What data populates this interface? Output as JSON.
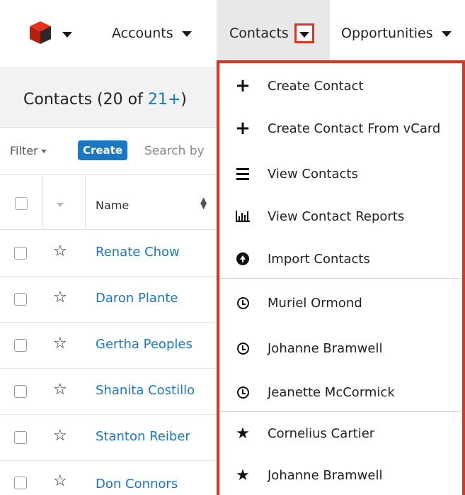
{
  "nav": {
    "logo": "sugar-cube-logo",
    "items": [
      {
        "label": "Accounts"
      },
      {
        "label": "Contacts"
      },
      {
        "label": "Opportunities"
      }
    ]
  },
  "list": {
    "title_prefix": "Contacts (20 of ",
    "title_count": "21+",
    "title_suffix": ")",
    "filter_label": "Filter",
    "create_label": "Create",
    "search_placeholder": "Search by",
    "name_column": "Name",
    "rows": [
      {
        "name": "Renate Chow"
      },
      {
        "name": "Daron Plante"
      },
      {
        "name": "Gertha Peoples"
      },
      {
        "name": "Shanita Costillo"
      },
      {
        "name": "Stanton Reiber"
      },
      {
        "name": "Don Connors"
      }
    ]
  },
  "menu": {
    "items": [
      {
        "label": "Create Contact",
        "icon": "plus-icon"
      },
      {
        "label": "Create Contact From vCard",
        "icon": "plus-icon"
      },
      {
        "label": "View Contacts",
        "icon": "list-icon"
      },
      {
        "label": "View Contact Reports",
        "icon": "bar-chart-icon"
      },
      {
        "label": "Import Contacts",
        "icon": "upload-circle-icon"
      },
      {
        "label": "Muriel Ormond",
        "icon": "clock-icon"
      },
      {
        "label": "Johanne Bramwell",
        "icon": "clock-icon"
      },
      {
        "label": "Jeanette McCormick",
        "icon": "clock-icon"
      },
      {
        "label": "Cornelius Cartier",
        "icon": "star-icon"
      },
      {
        "label": "Johanne Bramwell",
        "icon": "star-icon"
      }
    ]
  },
  "colors": {
    "highlight": "#e8321d",
    "link": "#1a78c2",
    "active_tab_bg": "#e8e8e8"
  }
}
